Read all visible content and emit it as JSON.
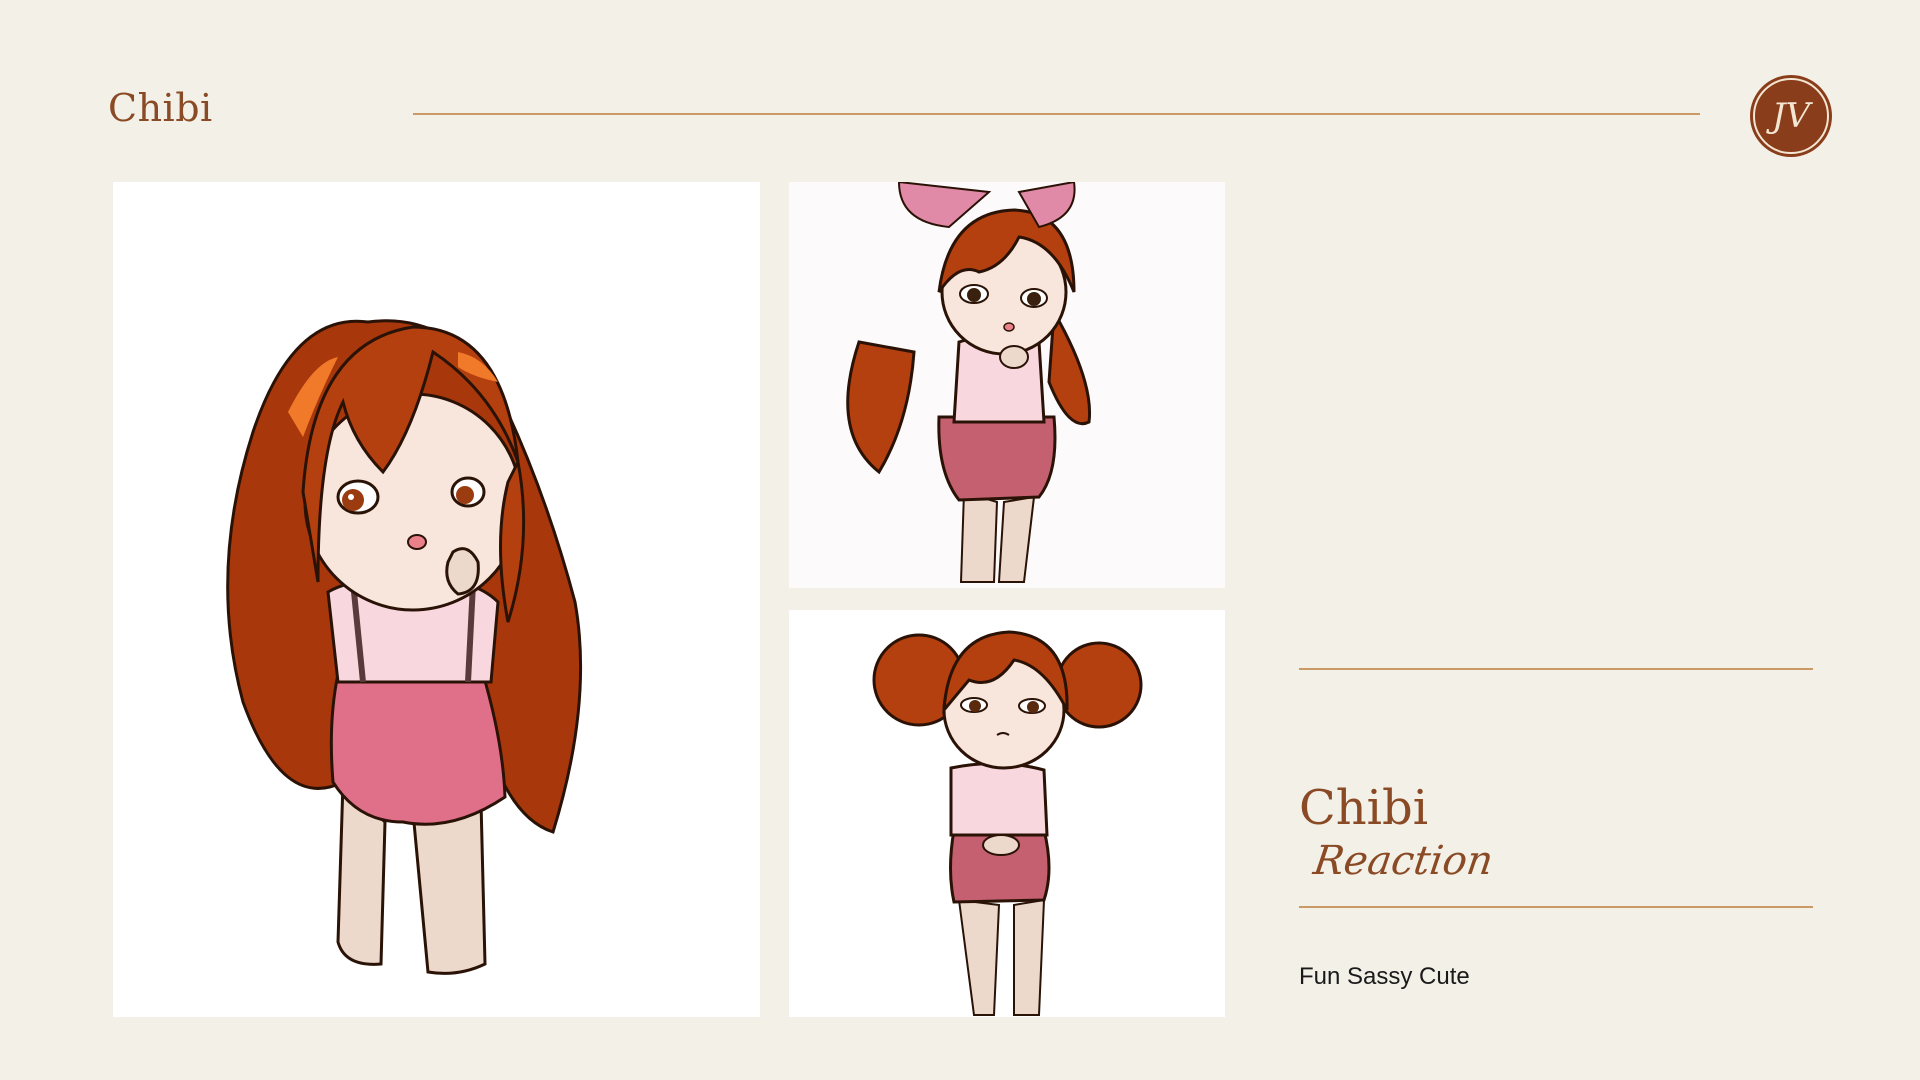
{
  "header": {
    "title": "Chibi"
  },
  "logo": {
    "monogram": "JV"
  },
  "gallery": {
    "images": [
      {
        "name": "long-hair-girl",
        "hair_color": "#b5400f",
        "outfit_color": "#e0708a"
      },
      {
        "name": "bow-girl",
        "hair_color": "#b5400f",
        "outfit_color": "#c46070"
      },
      {
        "name": "pigtails-girl",
        "hair_color": "#b5400f",
        "outfit_color": "#c46070"
      }
    ]
  },
  "sidebar": {
    "title": "Chibi",
    "subtitle": "Reaction",
    "tags": "Fun Sassy Cute"
  },
  "colors": {
    "background": "#f3f0e8",
    "accent": "#8a4a25",
    "rule": "#c99a66"
  }
}
